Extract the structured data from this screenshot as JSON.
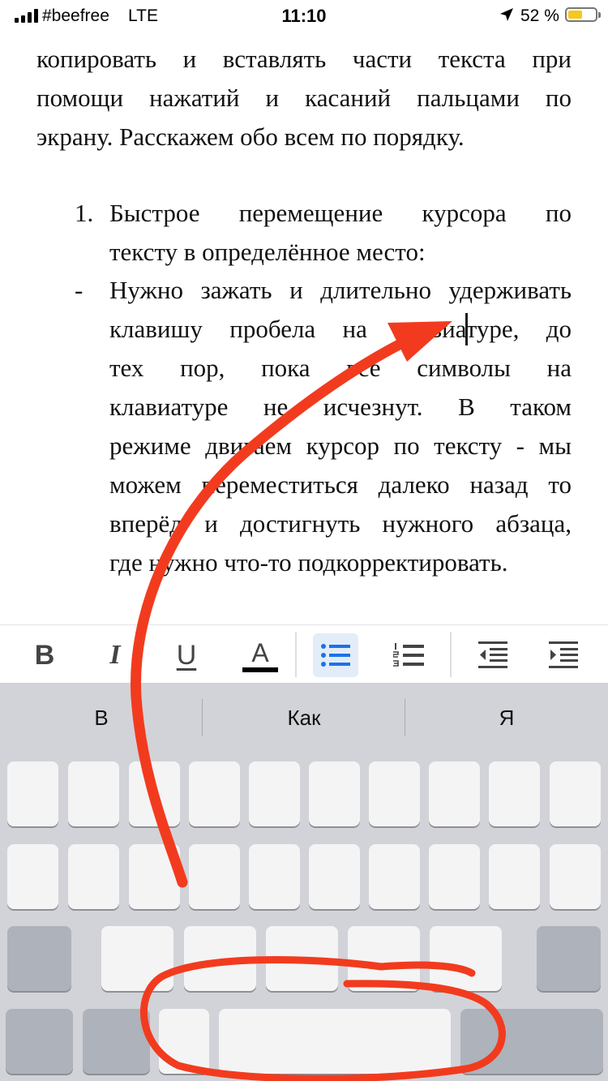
{
  "status_bar": {
    "carrier": "#beefree",
    "network": "LTE",
    "time": "11:10",
    "battery_percent": "52 %",
    "battery_level": 0.52
  },
  "document": {
    "lines": [
      "копировать и вставлять части текста при",
      "помощи нажатий и касаний пальцами по",
      "экрану. Расскажем обо всем по порядку.",
      "Быстрое перемещение курсора по",
      "тексту в определённое место:",
      "Нужно зажать и длительно удерживать",
      "клавишу пробела на клавиатуре, до",
      "тех пор, пока все символы на",
      "клавиатуре не исчезнут. В таком",
      "режиме двигаем курсор по тексту - мы",
      "можем переместиться далеко назад то",
      "вперёд и достигнуть нужного абзаца,",
      "где нужно что-то подкорректировать."
    ],
    "list_number": "1.",
    "list_bullet": "-"
  },
  "toolbar": {
    "bold": "B",
    "italic": "I",
    "underline": "U",
    "text_color": "A",
    "active_color": "#1a73e8",
    "icon_color": "#444444"
  },
  "keyboard": {
    "suggestions": [
      "В",
      "Как",
      "Я"
    ]
  },
  "annotation_color": "#f23b1e"
}
